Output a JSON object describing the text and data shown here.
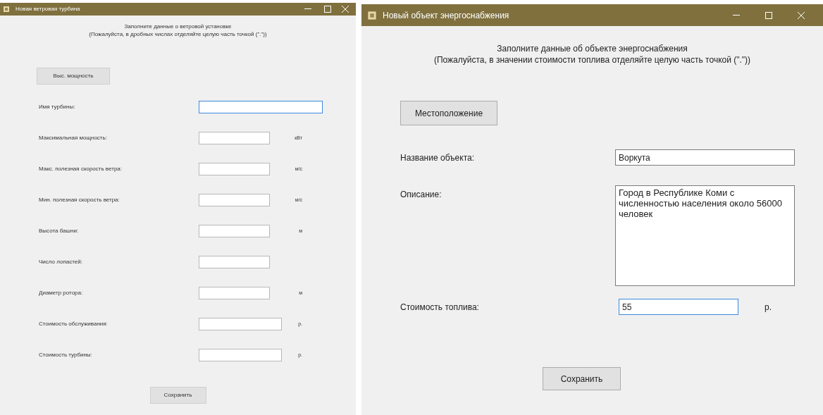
{
  "windows": [
    {
      "title": "Новая ветровая турбина",
      "heading": [
        "Заполните данные о ветровой установке",
        "(Пожалуйста, в дробных числах отделяйте целую часть точкой (\".\"))"
      ],
      "top_button": "Выс. мощность",
      "fields": [
        {
          "label": "Имя турбины:",
          "focused": true
        },
        {
          "label": "Максимальная мощность:",
          "unit": "кВт",
          "focused": false
        },
        {
          "label": "Макс. полезная скорость ветра:",
          "unit": "м/с",
          "focused": false
        },
        {
          "label": "Мин. полезная скорость ветра:",
          "unit": "м/с",
          "focused": false
        },
        {
          "label": "Высота башни:",
          "unit": "м",
          "focused": false
        },
        {
          "label": "Число лопастей:",
          "focused": false
        },
        {
          "label": "Диаметр ротора:",
          "unit": "м",
          "focused": false
        },
        {
          "label": "Стоимость обслуживания:",
          "unit": "р.",
          "focused": false
        },
        {
          "label": "Стоимость турбины:",
          "unit": "р.",
          "focused": false
        }
      ],
      "save_button": "Сохранить"
    },
    {
      "title": "Новый объект энергоснабжения",
      "heading": [
        "Заполните данные об объекте энергоснабжения",
        "(Пожалуйста, в значении стоимости топлива отделяйте целую часть точкой (\".\"))"
      ],
      "top_button": "Местоположение",
      "fields": [
        {
          "kind": "text",
          "label": "Название объекта:",
          "value": "Воркута",
          "focused": false
        },
        {
          "kind": "multiline",
          "label": "Описание:",
          "value": "Город в Республике Коми с численностью населения около 56000 человек",
          "focused": false
        },
        {
          "kind": "text",
          "label": "Стоимость топлива:",
          "value": "55",
          "unit": "р.",
          "focused": true
        }
      ],
      "save_button": "Сохранить"
    }
  ]
}
